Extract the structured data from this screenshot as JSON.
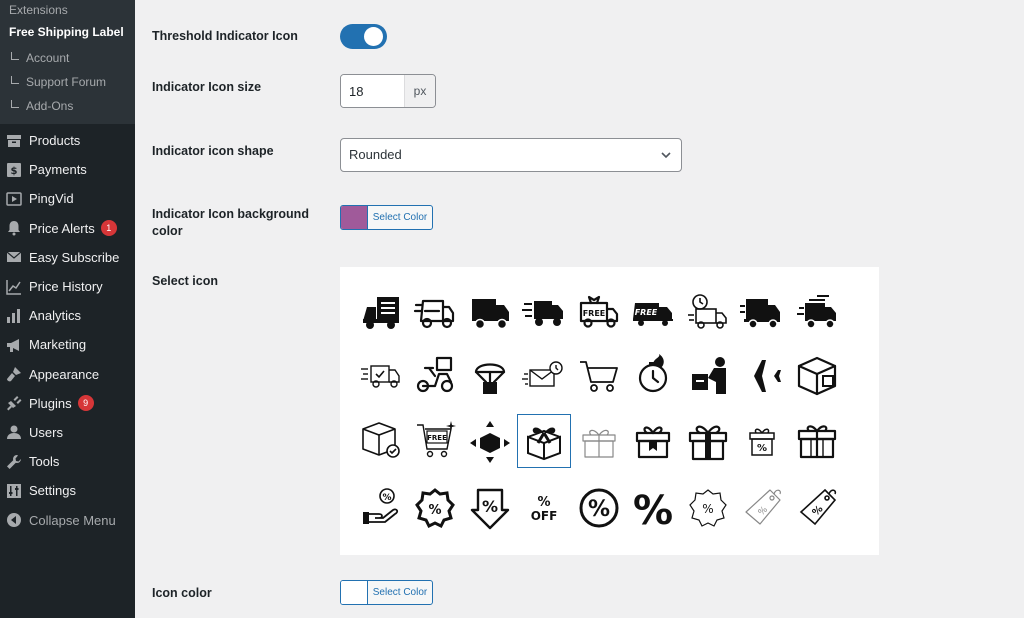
{
  "sidebar": {
    "submenu_top": "Extensions",
    "current": "Free Shipping Label",
    "children": [
      "Account",
      "Support Forum",
      "Add-Ons"
    ],
    "items": [
      {
        "label": "Products",
        "icon": "archive-icon"
      },
      {
        "label": "Payments",
        "icon": "dollar-icon"
      },
      {
        "label": "PingVid",
        "icon": "video-icon"
      },
      {
        "label": "Price Alerts",
        "icon": "bell-icon",
        "badge": "1"
      },
      {
        "label": "Easy Subscribe",
        "icon": "envelope-icon"
      },
      {
        "label": "Price History",
        "icon": "chart-line-icon"
      },
      {
        "label": "Analytics",
        "icon": "bar-chart-icon"
      },
      {
        "label": "Marketing",
        "icon": "megaphone-icon"
      },
      {
        "label": "Appearance",
        "icon": "paintbrush-icon"
      },
      {
        "label": "Plugins",
        "icon": "plug-icon",
        "badge": "9"
      },
      {
        "label": "Users",
        "icon": "user-icon"
      },
      {
        "label": "Tools",
        "icon": "wrench-icon"
      },
      {
        "label": "Settings",
        "icon": "sliders-icon"
      }
    ],
    "collapse": "Collapse Menu"
  },
  "fields": {
    "threshold_label": "Threshold Indicator Icon",
    "threshold_on": true,
    "size_label": "Indicator Icon size",
    "size_value": "18",
    "size_unit": "px",
    "shape_label": "Indicator icon shape",
    "shape_value": "Rounded",
    "bg_label": "Indicator Icon background color",
    "bg_color": "#a05a9a",
    "select_color_label": "Select Color",
    "select_icon_label": "Select icon",
    "icon_color_label": "Icon color",
    "icon_color": "#ffffff"
  },
  "icons": [
    [
      "truck-list-icon",
      "truck-fast-icon",
      "truck-solid-icon",
      "truck-speed-icon",
      "free-truck-gift-icon",
      "free-truck-icon",
      "clock-truck-icon",
      "truck-fast-solid-icon",
      "truck-motion-icon"
    ],
    [
      "truck-check-icon",
      "scooter-delivery-icon",
      "parachute-box-icon",
      "envelope-clock-icon",
      "cart-icon",
      "fast-clock-icon",
      "delivery-person-icon",
      "airplane-icon",
      "box-3d-icon"
    ],
    [
      "box-check-icon",
      "free-cart-icon",
      "box-arrows-icon",
      "gift-box-bow-icon",
      "gift-outline-icon",
      "gift-tag-icon",
      "gift-big-icon",
      "gift-percent-icon",
      "gift-ribbon-icon"
    ],
    [
      "hand-percent-icon",
      "badge-percent-icon",
      "arrow-percent-icon",
      "percent-off-icon",
      "percent-circle-icon",
      "percent-large-icon",
      "badge-percent-outline-icon",
      "price-tag-outline-icon",
      "price-tag-percent-icon"
    ]
  ],
  "selected_icon": "gift-box-bow-icon",
  "percent_off_text": [
    "%",
    "OFF"
  ],
  "free_text": "FREE"
}
